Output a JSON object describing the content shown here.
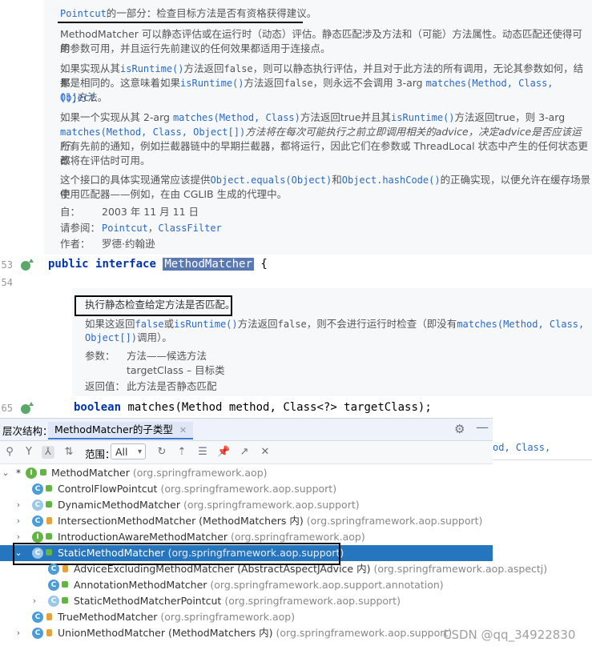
{
  "doc_top": {
    "title_link": "Pointcut",
    "title_rest": "的一部分：检查目标方法是否有资格获得建议。",
    "p1_l1": "MethodMatcher 可以静态评估或在运行时（动态）评估。静态匹配涉及方法和（可能）方法属性。动态匹配还使得可用",
    "p1_l2": "的参数可用，并且运行先前建议的任何效果都适用于连接点。",
    "p2_l1a": "如果实现从其",
    "p2_l1_code1": "isRuntime()",
    "p2_l1b": "方法返回",
    "p2_l1_code2": "false",
    "p2_l1c": "，则可以静态执行评估，并且对于此方法的所有调用，无论其参数如何，结果",
    "p2_l2a": "都是相同的。这意味着如果",
    "p2_l2_code1": "isRuntime()",
    "p2_l2b": "方法返回",
    "p2_l2_code2": "false",
    "p2_l2c": "，则永远不会调用 3-arg ",
    "p2_l2_code3": "matches(Method, Class, Object",
    "p2_l3_code": "[])",
    "p2_l3b": "方法。",
    "p3_l1a": "如果一个实现从其 2-arg ",
    "p3_l1_code1": "matches(Method, Class)",
    "p3_l1b": "方法返回true并且其",
    "p3_l1_code2": "isRuntime()",
    "p3_l1c": "方法返回true，则 3-arg",
    "p3_l2_code": "matches(Method, Class, Object[])",
    "p3_l2b": "方法将在每次可能执行之前立即调用相关的advice，决定advice是否应该运行。",
    "p3_l3": "所有先前的通知，例如拦截器链中的早期拦截器，都将运行，因此它们在参数或 ThreadLocal 状态中产生的任何状态更改",
    "p3_l4": "都将在评估时可用。",
    "p4_l1a": "这个接口的具体实现通常应该提供",
    "p4_l1_code1": "Object.equals(Object)",
    "p4_l1b": "和",
    "p4_l1_code2": "Object.hashCode()",
    "p4_l1c": "的正确实现，以便允许在缓存场景中",
    "p4_l2": "使用匹配器——例如，在由 CGLIB 生成的代理中。",
    "since_label": "自：",
    "since_value": "2003 年 11 月 11 日",
    "see_label": "请参阅：",
    "see_link1": "Pointcut",
    "see_sep": "，",
    "see_link2": "ClassFilter",
    "author_label": "作者：",
    "author_value": "罗德·约翰逊"
  },
  "code": {
    "line53_num": "53",
    "line54_num": "54",
    "line65_num": "65",
    "kw_public": "public",
    "kw_interface": "interface",
    "type_name": "MethodMatcher",
    "brace": "{",
    "kw_boolean": "boolean",
    "method_sig": "matches(Method method, Class<?> targetClass);",
    "partial_code": "od, Class,"
  },
  "doc_method": {
    "summary": "执行静态检查给定方法是否匹配。",
    "l1a": "如果这返回",
    "l1_code1": "false",
    "l1b": "或",
    "l1_code2": "isRuntime()",
    "l1c": "方法返回",
    "l1_code3": "false",
    "l1d": "，则不会进行运行时检查（即没有",
    "l1_code4": "matches(Method, Class,",
    "l2_code": "Object[])",
    "l2b": "调用）。",
    "params_label": "参数：",
    "param1": "方法——候选方法",
    "param2": "targetClass – 目标类",
    "returns_label": "返回值：",
    "returns_value": "此方法是否静态匹配"
  },
  "hierarchy": {
    "header_label": "层次结构：",
    "tab_label": "MethodMatcher的子类型",
    "scope_label": "范围：",
    "scope_value": "All",
    "rows": [
      {
        "name": "MethodMatcher",
        "pkg": "(org.springframework.aop)"
      },
      {
        "name": "ControlFlowPointcut",
        "pkg": "(org.springframework.aop.support)"
      },
      {
        "name": "DynamicMethodMatcher",
        "pkg": "(org.springframework.aop.support)"
      },
      {
        "name": "IntersectionMethodMatcher (MethodMatchers 内)",
        "pkg": "(org.springframework.aop.support)"
      },
      {
        "name": "IntroductionAwareMethodMatcher",
        "pkg": "(org.springframework.aop)"
      },
      {
        "name": "StaticMethodMatcher",
        "pkg": "(org.springframework.aop.support)"
      },
      {
        "name": "AdviceExcludingMethodMatcher (AbstractAspectJAdvice 内)",
        "pkg": "(org.springframework.aop.aspectj)"
      },
      {
        "name": "AnnotationMethodMatcher",
        "pkg": "(org.springframework.aop.support.annotation)"
      },
      {
        "name": "StaticMethodMatcherPointcut",
        "pkg": "(org.springframework.aop.support)"
      },
      {
        "name": "TrueMethodMatcher",
        "pkg": "(org.springframework.aop)"
      },
      {
        "name": "UnionMethodMatcher (MethodMatchers 内)",
        "pkg": "(org.springframework.aop.support)"
      }
    ]
  },
  "watermark": "CSDN @qq_34922830"
}
